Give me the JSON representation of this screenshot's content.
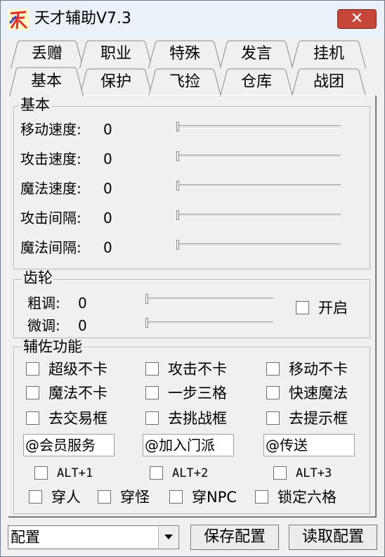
{
  "window": {
    "title": "天才辅助V7.3",
    "close_label": "✕",
    "accent_close": "#c7463a"
  },
  "tabs": {
    "row1": [
      "丢赠",
      "职业",
      "特殊",
      "发言",
      "挂机"
    ],
    "row2": [
      "基本",
      "保护",
      "飞捡",
      "仓库",
      "战团"
    ],
    "active": "基本"
  },
  "basic": {
    "legend": "基本",
    "sliders": [
      {
        "label": "移动速度:",
        "value": "0"
      },
      {
        "label": "攻击速度:",
        "value": "0"
      },
      {
        "label": "魔法速度:",
        "value": "0"
      },
      {
        "label": "攻击间隔:",
        "value": "0"
      },
      {
        "label": "魔法间隔:",
        "value": "0"
      }
    ]
  },
  "gear": {
    "legend": "齿轮",
    "coarse_label": "粗调:",
    "coarse_value": "0",
    "fine_label": "微调:",
    "fine_value": "0",
    "enable_label": "开启"
  },
  "assist": {
    "legend": "辅佐功能",
    "checkboxes": [
      "超级不卡",
      "攻击不卡",
      "移动不卡",
      "魔法不卡",
      "一步三格",
      "快速魔法",
      "去交易框",
      "去挑战框",
      "去提示框"
    ],
    "inputs": [
      "@会员服务",
      "@加入门派",
      "@传送"
    ],
    "hotkeys": [
      "ALT+1",
      "ALT+2",
      "ALT+3"
    ],
    "bottom": [
      "穿人",
      "穿怪",
      "穿NPC",
      "锁定六格"
    ]
  },
  "footer": {
    "config_value": "配置",
    "save_label": "保存配置",
    "load_label": "读取配置"
  }
}
